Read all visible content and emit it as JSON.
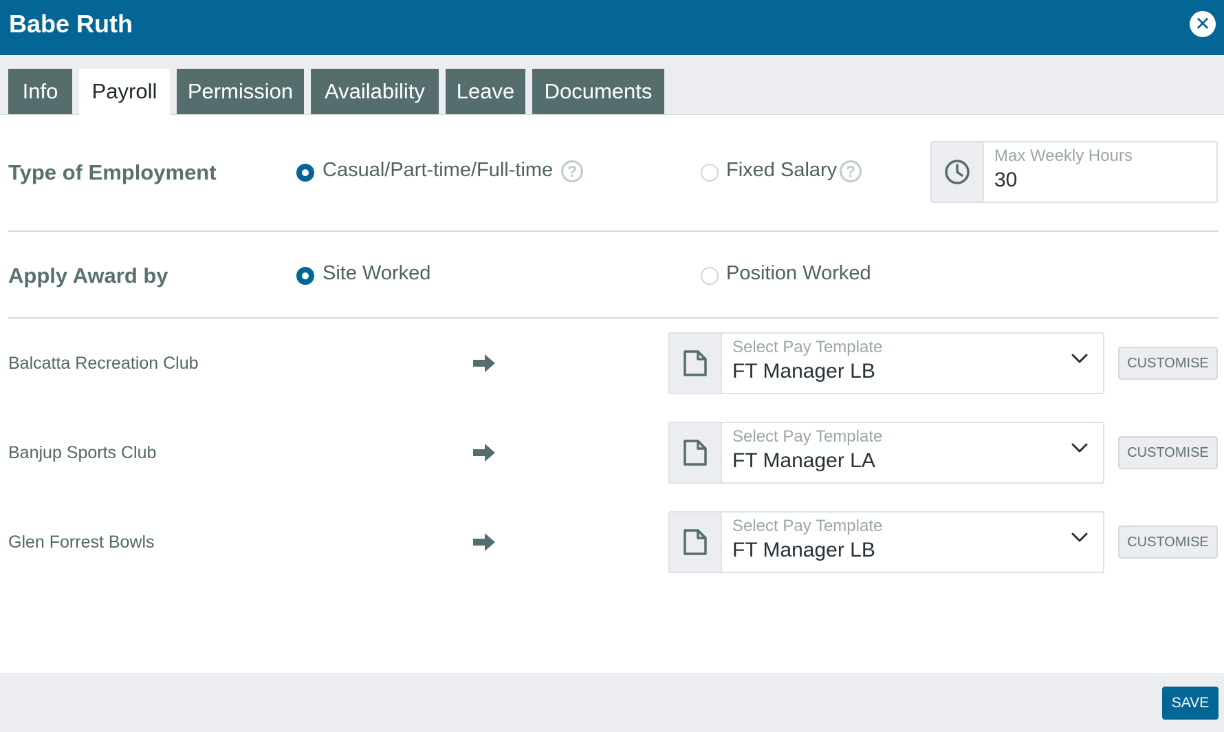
{
  "window": {
    "title": "Babe Ruth",
    "close_icon": "close-icon"
  },
  "tabs": [
    {
      "label": "Info",
      "active": false
    },
    {
      "label": "Payroll",
      "active": true
    },
    {
      "label": "Permission",
      "active": false
    },
    {
      "label": "Availability",
      "active": false
    },
    {
      "label": "Leave",
      "active": false
    },
    {
      "label": "Documents",
      "active": false
    }
  ],
  "employment": {
    "label": "Type of Employment",
    "options": [
      {
        "label": "Casual/Part-time/Full-time",
        "checked": true
      },
      {
        "label": "Fixed Salary",
        "checked": false
      }
    ],
    "max_weekly_hours": {
      "label": "Max Weekly Hours",
      "value": "30",
      "icon": "clock-icon"
    }
  },
  "award": {
    "label": "Apply Award by",
    "options": [
      {
        "label": "Site Worked",
        "checked": true
      },
      {
        "label": "Position Worked",
        "checked": false
      }
    ]
  },
  "sites": [
    {
      "name": "Balcatta Recreation Club",
      "template_label": "Select Pay Template",
      "template_value": "FT Manager LB",
      "customise_label": "CUSTOMISE"
    },
    {
      "name": "Banjup Sports Club",
      "template_label": "Select Pay Template",
      "template_value": "FT Manager LA",
      "customise_label": "CUSTOMISE"
    },
    {
      "name": "Glen Forrest Bowls",
      "template_label": "Select Pay Template",
      "template_value": "FT Manager LB",
      "customise_label": "CUSTOMISE"
    }
  ],
  "footer": {
    "save_label": "SAVE"
  },
  "colors": {
    "primary": "#046694",
    "tab_inactive": "#566d6d",
    "panel_bg": "#ebedf0"
  }
}
